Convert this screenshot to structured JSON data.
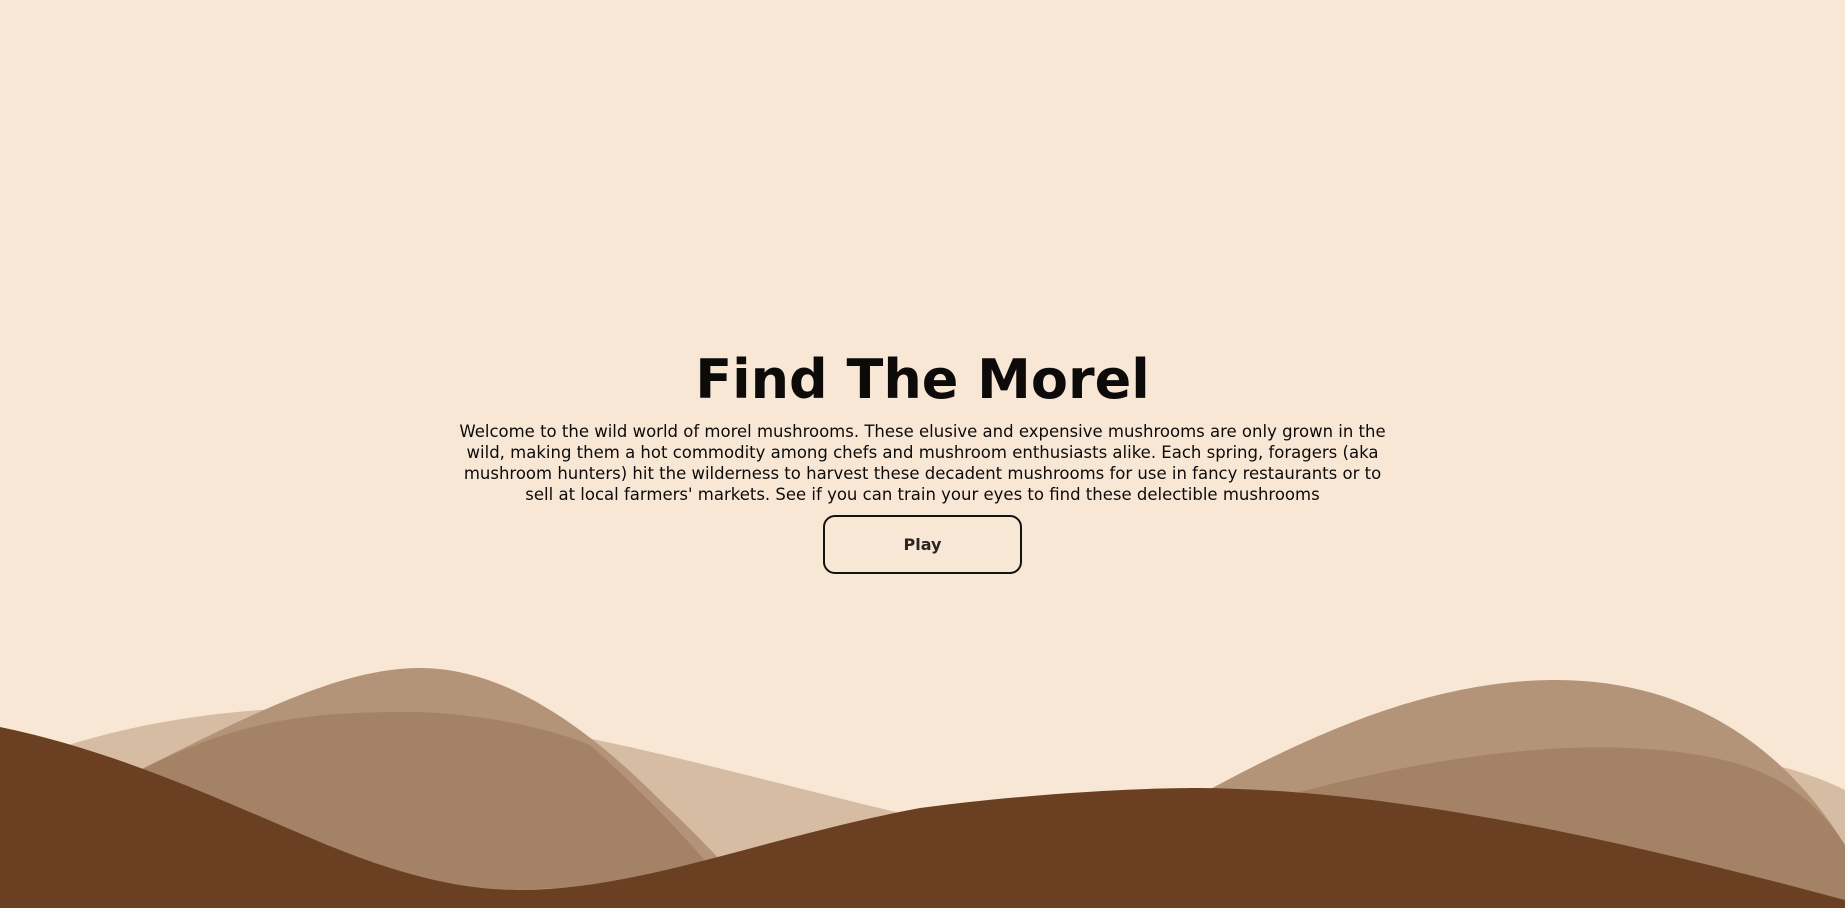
{
  "title": "Find The Morel",
  "intro": "Welcome to the wild world of morel mushrooms. These elusive and expensive mushrooms are only grown in the wild, making them a hot commodity among chefs and mushroom enthusiasts alike. Each spring, foragers (aka mushroom hunters) hit the wilderness to harvest these decadent mushrooms for use in fancy restaurants or to sell at local farmers' markets. See if you can train your eyes to find these delectible mushrooms",
  "play_label": "Play",
  "colors": {
    "background": "#f9e7d5",
    "hill_light": "#d6bca3",
    "hill_mid": "#b39478",
    "hill_overlap": "#a38265",
    "hill_dark": "#6b3f22",
    "text": "#0d0b0a"
  }
}
